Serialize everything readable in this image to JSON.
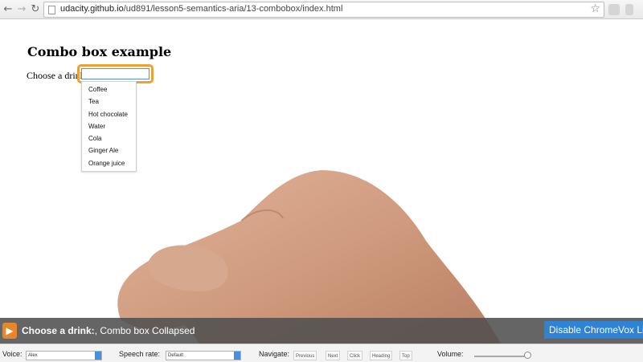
{
  "browser": {
    "url_host": "udacity.github.io",
    "url_path": "/ud891/lesson5-semantics-aria/13-combobox/index.html"
  },
  "page": {
    "heading": "Combo box example",
    "combo_label": "Choose a drink:",
    "combo_value": "",
    "options": [
      "Coffee",
      "Tea",
      "Hot chocolate",
      "Water",
      "Cola",
      "Ginger Ale",
      "Orange juice"
    ]
  },
  "chromevox": {
    "caption_bold": "Choose a drink:",
    "caption_rest": ", Combo box Collapsed",
    "disable_label": "Disable ChromeVox Lit",
    "voice_label": "Voice:",
    "voice_value": "Alex",
    "rate_label": "Speech rate:",
    "rate_value": "Default",
    "navigate_label": "Navigate:",
    "nav_buttons": [
      "Previous",
      "Next",
      "Click",
      "Heading",
      "Top"
    ],
    "volume_label": "Volume:",
    "volume_level": 0.95
  },
  "colors": {
    "focus_ring": "#f0a030",
    "button_blue": "#2f83d4",
    "logo_orange": "#e8872a"
  },
  "icons": [
    "back-arrow-icon",
    "forward-arrow-icon",
    "reload-icon",
    "page-icon",
    "star-icon",
    "chromevox-logo-icon"
  ]
}
